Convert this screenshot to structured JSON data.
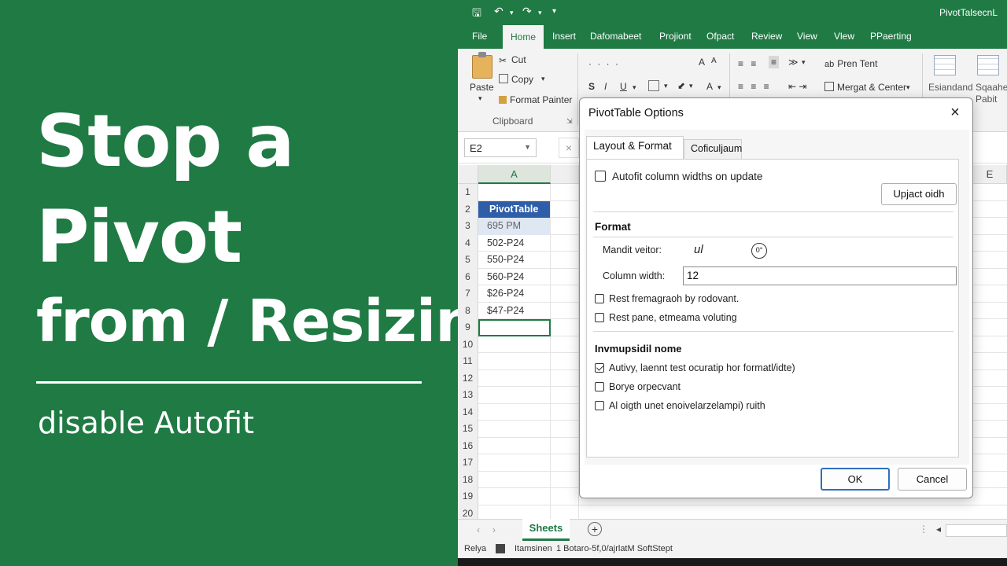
{
  "promo": {
    "line1": "Stop a",
    "line2": "Pivot",
    "line3": "from / Resizing",
    "subtitle": "disable Autofit"
  },
  "window": {
    "title": "PivotTalsecnL",
    "qat": {
      "save": "🖫",
      "undo": "↶",
      "redo": "↷",
      "more": "▾"
    }
  },
  "ribbon_tabs": [
    "File",
    "Home",
    "Insert",
    "Dafomabeet",
    "Projiont",
    "Ofpact",
    "Review",
    "View",
    "Vlew",
    "PPaerting"
  ],
  "active_tab": "Home",
  "clipboard": {
    "paste": "Paste",
    "cut": "Cut",
    "copy": "Copy",
    "format_painter": "Format Painter",
    "group_label": "Clipboard"
  },
  "font_group": {
    "row1": "·  ·    ·     ·",
    "grow": "A",
    "shrink": "A",
    "bold": "S",
    "italic": "I",
    "underline": "U"
  },
  "alignment": {
    "wrap_text": "Pren Tent",
    "merge_center": "Mergat & Center"
  },
  "styles": {
    "item1": "Esiandand",
    "item2": "Sqaahe",
    "item2b": "Pabit"
  },
  "formula_bar": {
    "name_box": "E2",
    "cancel": "×"
  },
  "sheet": {
    "col_a": "A",
    "col_e": "E",
    "rows": [
      {
        "n": "1",
        "a": ""
      },
      {
        "n": "2",
        "a": "PivotTable"
      },
      {
        "n": "3",
        "a": "695 PM"
      },
      {
        "n": "4",
        "a": "502-P24"
      },
      {
        "n": "5",
        "a": "550-P24"
      },
      {
        "n": "6",
        "a": "560-P24"
      },
      {
        "n": "7",
        "a": "$26-P24"
      },
      {
        "n": "8",
        "a": "$47-P24"
      },
      {
        "n": "9",
        "a": ""
      },
      {
        "n": "10",
        "a": ""
      },
      {
        "n": "11",
        "a": ""
      },
      {
        "n": "12",
        "a": ""
      },
      {
        "n": "13",
        "a": ""
      },
      {
        "n": "14",
        "a": ""
      },
      {
        "n": "15",
        "a": ""
      },
      {
        "n": "16",
        "a": ""
      },
      {
        "n": "17",
        "a": ""
      },
      {
        "n": "18",
        "a": ""
      },
      {
        "n": "19",
        "a": ""
      },
      {
        "n": "20",
        "a": ""
      }
    ],
    "tab_name": "Sheets",
    "add_sheet": "+"
  },
  "status": {
    "ready": "Relya",
    "mode": "Itamsinen",
    "info": "1 Botaro-5f,0/ajrlatM SoftStept"
  },
  "dialog": {
    "title": "PivotTable Options",
    "close": "×",
    "tabs": [
      "Layout & Format",
      "Coficuljaum"
    ],
    "autofit_label": "Autofit column widths on update",
    "autofit_checked": false,
    "update_button": "Upjact oidh",
    "format_heading": "Format",
    "mandit_label": "Mandit veitor:",
    "mandit_value": "ul",
    "mandit_circle": "0°",
    "column_width_label": "Column width:",
    "column_width_value": "12",
    "option1": "Rest fremagraoh by rodovant.",
    "option1_checked": false,
    "option2": "Rest pane, etmeama voluting",
    "option2_checked": false,
    "section2_heading": "Invmupsidil nome",
    "opt3": "Autivy, laennt test ocuratip hor formatl/idte)",
    "opt3_checked": true,
    "opt4": "Borye orpecvant",
    "opt4_checked": false,
    "opt5": "Al oigth unet enoivelarzelampi) ruith",
    "opt5_checked": false,
    "ok": "OK",
    "cancel": "Cancel"
  },
  "colors": {
    "excel_green": "#1f7a44",
    "pivot_header_blue": "#2f5ea8",
    "ok_border": "#2f6fbf"
  }
}
